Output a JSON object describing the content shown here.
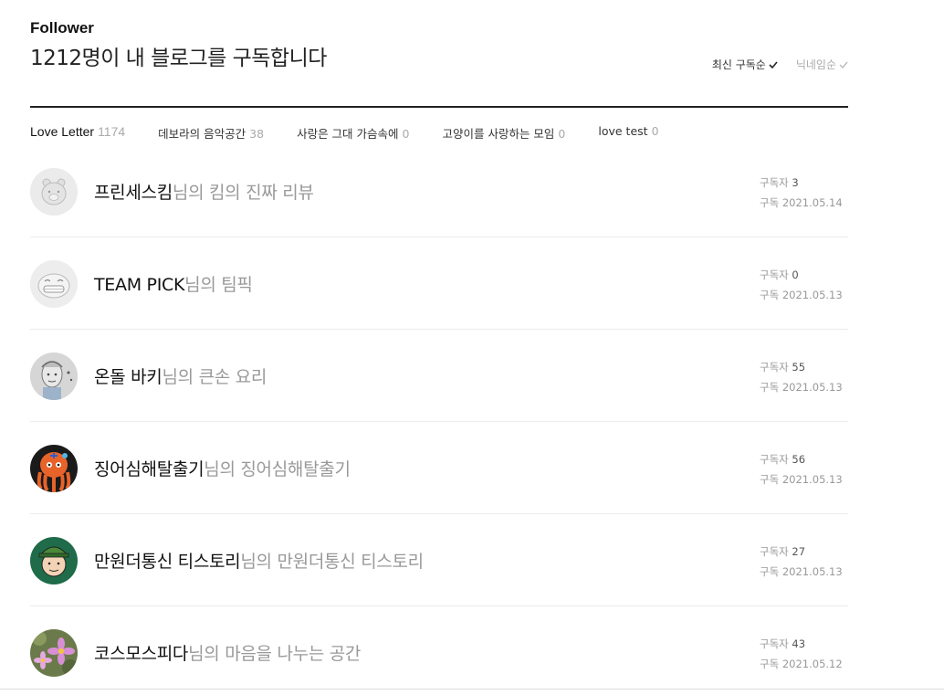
{
  "header": {
    "label": "Follower",
    "title": "1212명이 내 블로그를 구독합니다",
    "sort_options": [
      {
        "label": "최신 구독순",
        "active": true
      },
      {
        "label": "닉네임순",
        "active": false
      }
    ]
  },
  "tabs": [
    {
      "label": "Love Letter",
      "count": "1174"
    },
    {
      "label": "데보라의 음악공간",
      "count": "38"
    },
    {
      "label": "사랑은 그대 가슴속에",
      "count": "0"
    },
    {
      "label": "고양이를 사랑하는 모임",
      "count": "0"
    },
    {
      "label": "love test",
      "count": "0"
    }
  ],
  "subscribers": [
    {
      "name": "프린세스킴",
      "suffix": "님의 킴의 진짜 리뷰",
      "subscribers_label": "구독자",
      "subscribers": "3",
      "date_label": "구독",
      "date": "2021.05.14"
    },
    {
      "name": "TEAM PICK",
      "suffix": "님의 팀픽",
      "subscribers_label": "구독자",
      "subscribers": "0",
      "date_label": "구독",
      "date": "2021.05.13"
    },
    {
      "name": "온돌 바키",
      "suffix": "님의 큰손 요리",
      "subscribers_label": "구독자",
      "subscribers": "55",
      "date_label": "구독",
      "date": "2021.05.13"
    },
    {
      "name": "징어심해탈출기",
      "suffix": "님의 징어심해탈출기",
      "subscribers_label": "구독자",
      "subscribers": "56",
      "date_label": "구독",
      "date": "2021.05.13"
    },
    {
      "name": "만원더통신 티스토리",
      "suffix": "님의 만원더통신 티스토리",
      "subscribers_label": "구독자",
      "subscribers": "27",
      "date_label": "구독",
      "date": "2021.05.13"
    },
    {
      "name": "코스모스피다",
      "suffix": "님의 마음을 나누는 공간",
      "subscribers_label": "구독자",
      "subscribers": "43",
      "date_label": "구독",
      "date": "2021.05.12"
    }
  ]
}
